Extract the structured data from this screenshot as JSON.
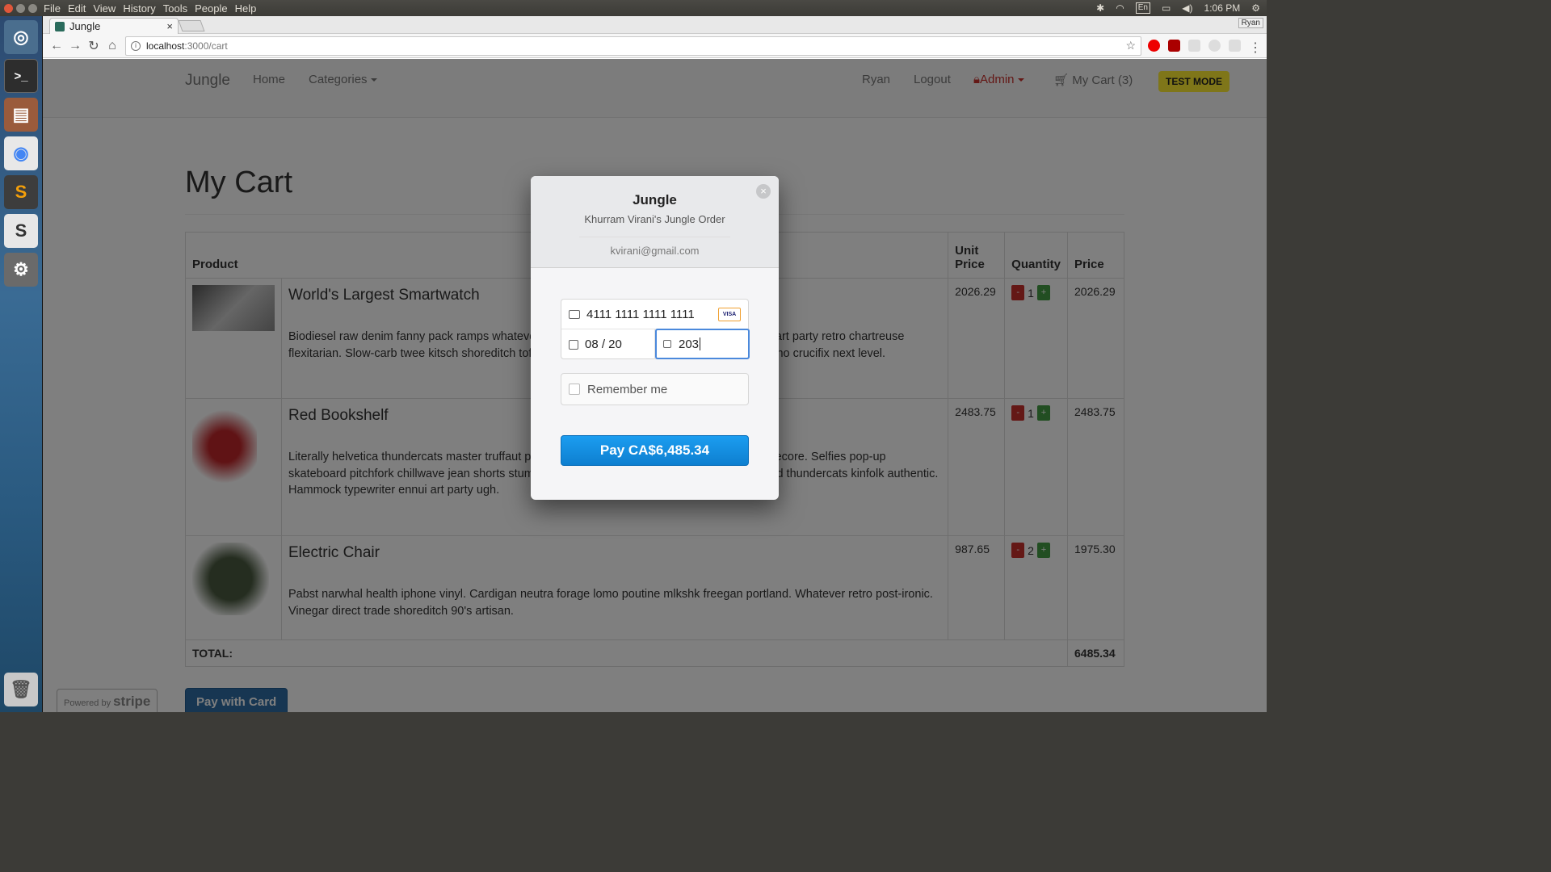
{
  "os": {
    "menu": [
      "File",
      "Edit",
      "View",
      "History",
      "Tools",
      "People",
      "Help"
    ],
    "tray_lang": "En",
    "clock": "1:06 PM"
  },
  "browser": {
    "tab_title": "Jungle",
    "tab_close": "×",
    "profile": "Ryan",
    "url_host": "localhost",
    "url_path": ":3000/cart"
  },
  "nav": {
    "brand": "Jungle",
    "home": "Home",
    "categories": "Categories",
    "user": "Ryan",
    "logout": "Logout",
    "admin": "Admin",
    "cart": "My Cart (3)",
    "test_mode": "TEST MODE"
  },
  "page": {
    "title": "My Cart",
    "headers": {
      "product": "Product",
      "unit_price": "Unit Price",
      "quantity": "Quantity",
      "price": "Price"
    },
    "items": [
      {
        "name": "World's Largest Smartwatch",
        "desc": "Biodiesel raw denim fanny pack ramps whatever hashtag chillwave hoodie forage. Food truck art party retro chartreuse flexitarian. Slow-carb twee kitsch shoreditch tofu ethical. Lo-fi iphone helvetica listicle. Hella echo crucifix next level.",
        "unit_price": "2026.29",
        "qty": "1",
        "price": "2026.29"
      },
      {
        "name": "Red Bookshelf",
        "desc": "Literally helvetica thundercats master truffaut pinterest kale chips beard schlitz freegan mumblecore. Selfies pop-up skateboard pitchfork chillwave jean shorts stumptown literally lo-fi beard scenester. Knausgaard thundercats kinfolk authentic. Hammock typewriter ennui art party ugh.",
        "unit_price": "2483.75",
        "qty": "1",
        "price": "2483.75"
      },
      {
        "name": "Electric Chair",
        "desc": "Pabst narwhal health iphone vinyl. Cardigan neutra forage lomo poutine mlkshk freegan portland. Whatever retro post-ironic. Vinegar direct trade shoreditch 90's artisan.",
        "unit_price": "987.65",
        "qty": "2",
        "price": "1975.30"
      }
    ],
    "minus": "-",
    "plus": "+",
    "total_label": "TOTAL:",
    "total_value": "6485.34",
    "pay_with_card": "Pay with Card",
    "powered_by": "Powered by",
    "stripe": "stripe"
  },
  "modal": {
    "title": "Jungle",
    "subtitle": "Khurram Virani's Jungle Order",
    "email": "kvirani@gmail.com",
    "card_number": "4111 1111 1111 1111",
    "card_brand": "VISA",
    "expiry": "08 / 20",
    "cvc": "203",
    "remember": "Remember me",
    "pay_button": "Pay CA$6,485.34",
    "close": "×"
  },
  "colors": {
    "accent": "#1b9df0",
    "admin": "#c9302c",
    "test_mode": "#ffec33"
  }
}
